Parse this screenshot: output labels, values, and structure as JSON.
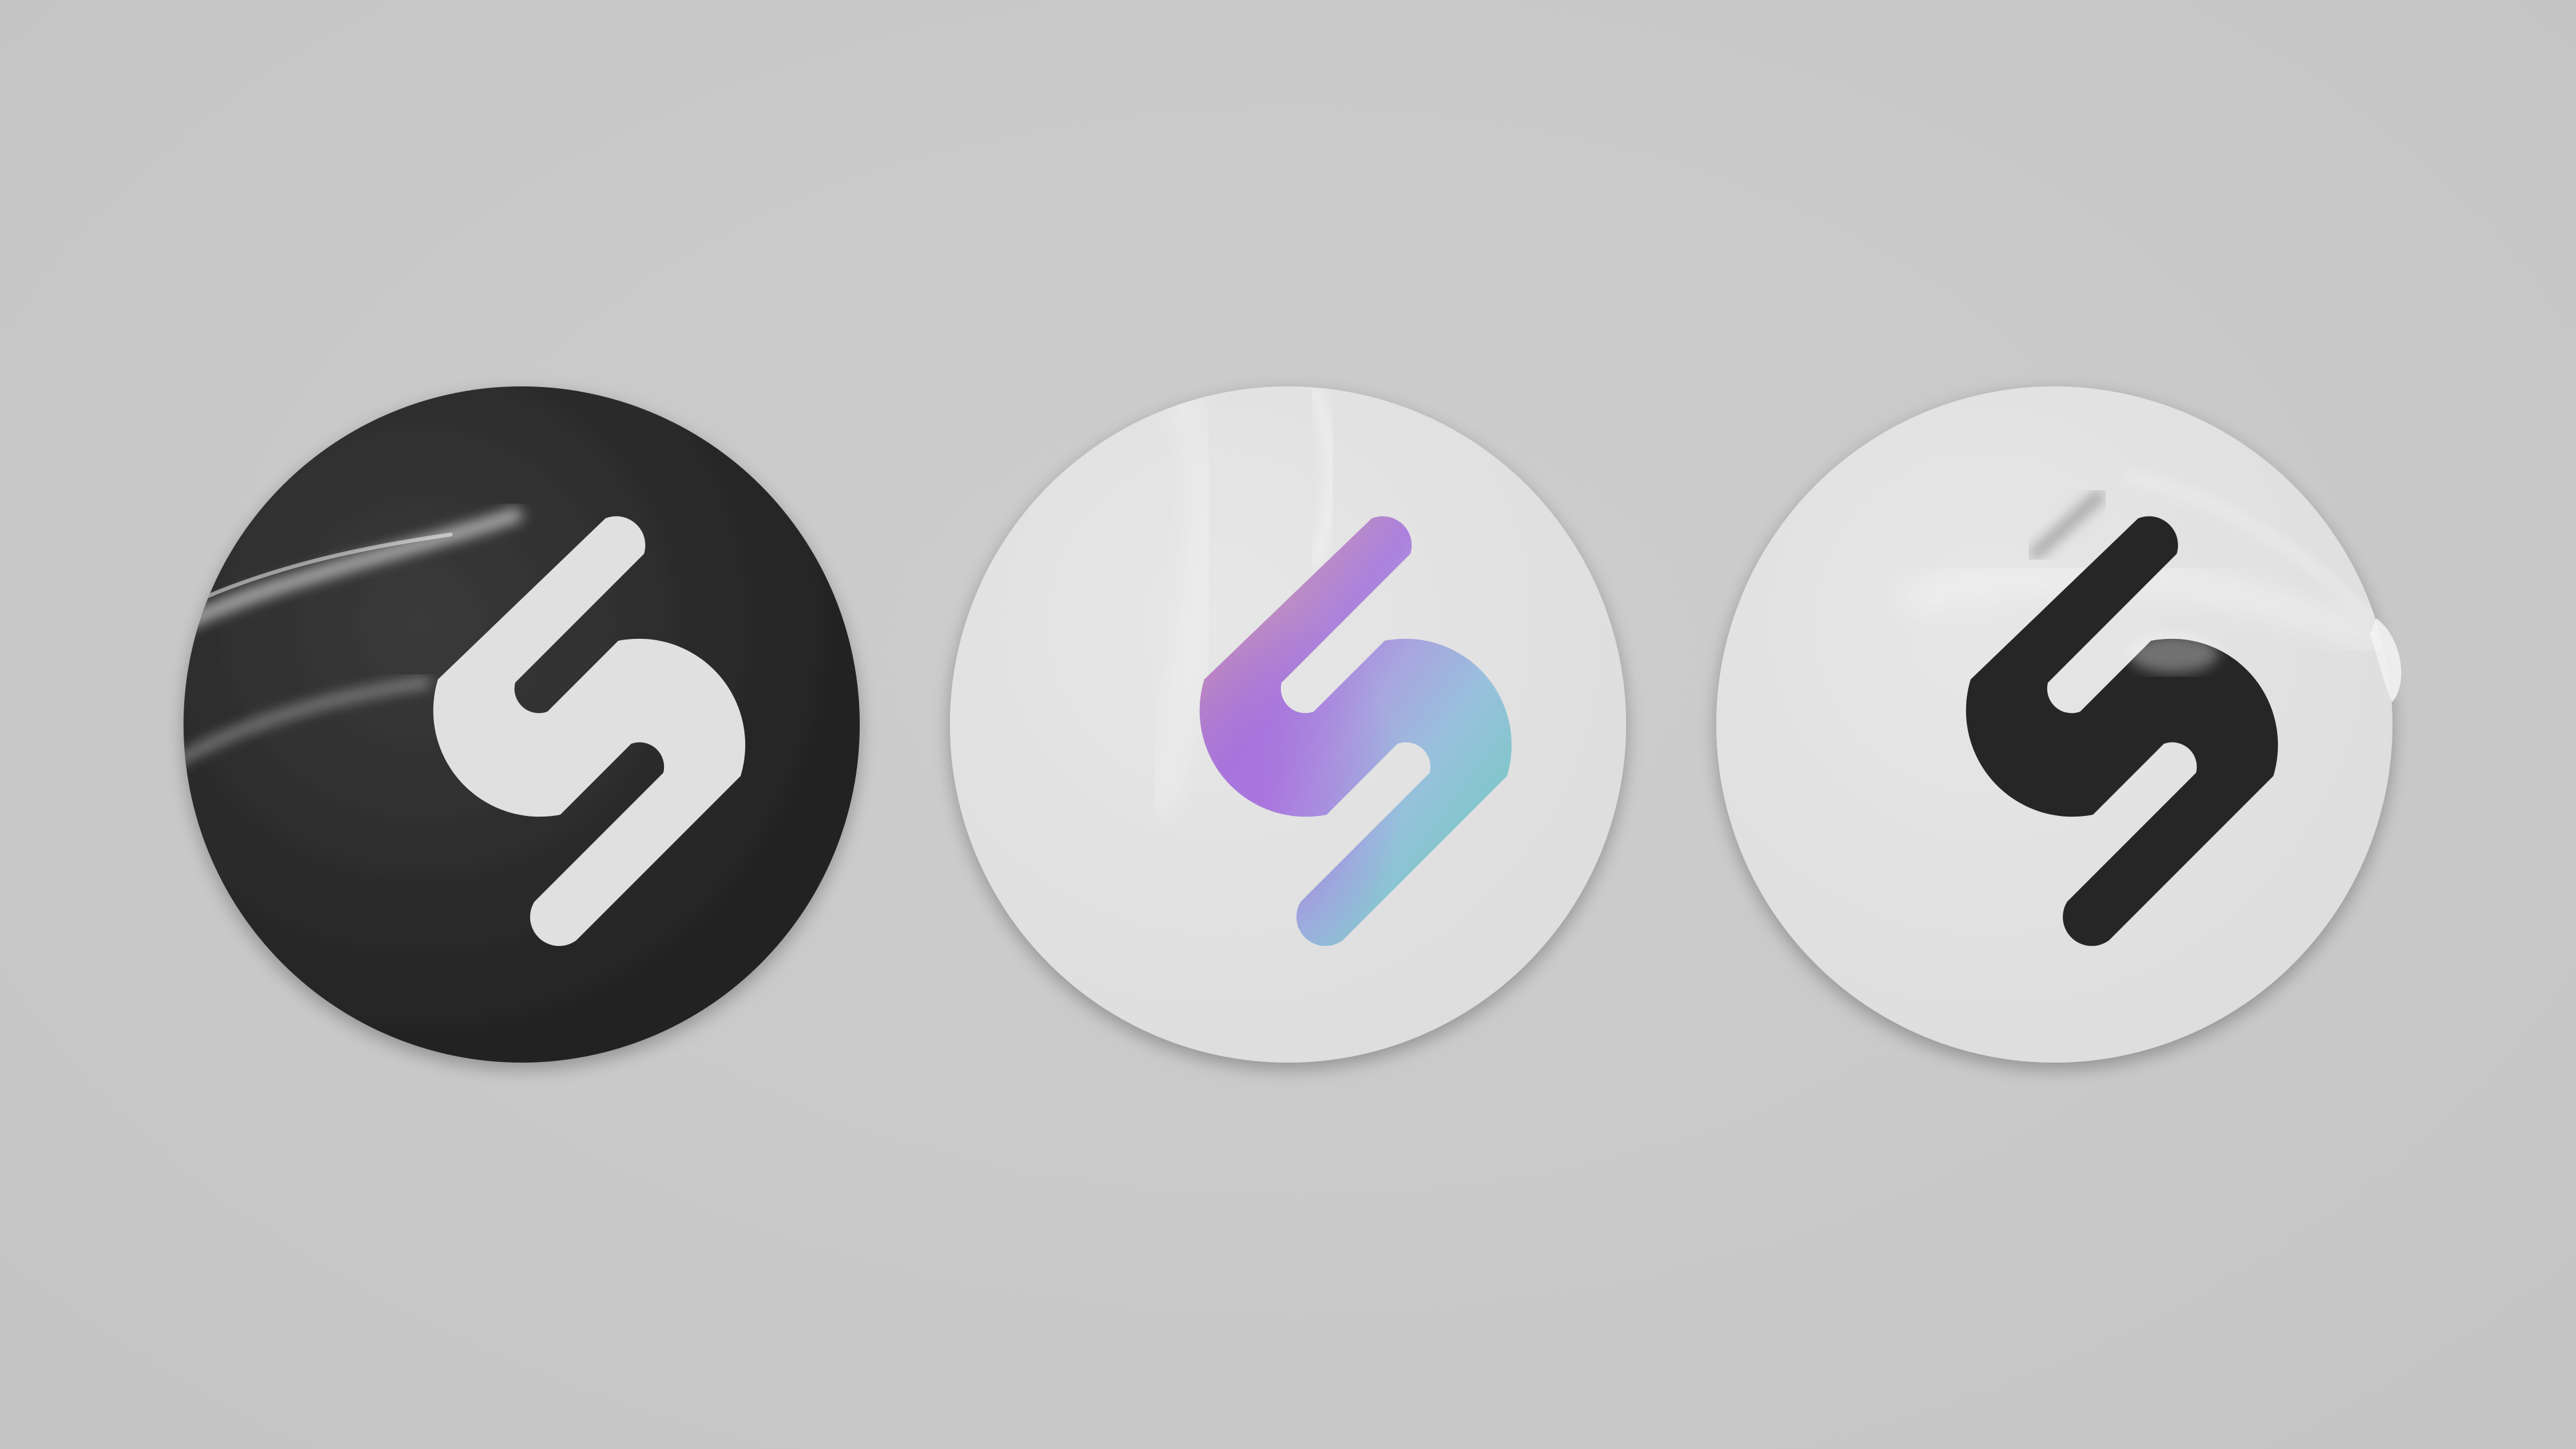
{
  "scene": {
    "background_color": "#c9c9c9",
    "stickers": [
      {
        "style": "dark",
        "base_color": "#262626",
        "logo_color": "#e0e0e0"
      },
      {
        "style": "holographic",
        "base_color": "#e1e1e1",
        "logo_gradient": [
          "#e4a88a",
          "#a070d8",
          "#8ab8d8",
          "#60d0b0"
        ]
      },
      {
        "style": "light",
        "base_color": "#e1e1e1",
        "logo_color": "#262626"
      }
    ],
    "logo_icon": "s-monogram-icon"
  }
}
